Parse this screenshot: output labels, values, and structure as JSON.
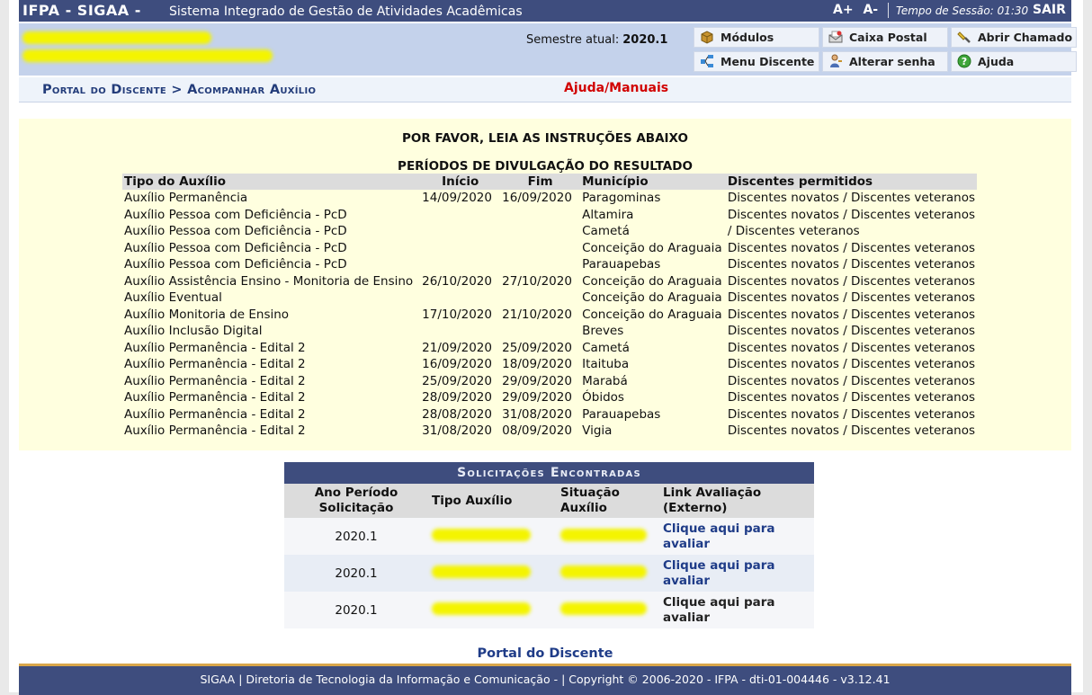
{
  "header": {
    "brand": "IFPA - SIGAA -",
    "system_name": "Sistema Integrado de Gestão de Atividades Acadêmicas",
    "font_increase": "A+",
    "font_decrease": "A-",
    "session": "Tempo de Sessão: 01:30",
    "logout": "SAIR"
  },
  "userbar": {
    "semester_label": "Semestre atual:",
    "semester_value": "2020.1",
    "menu": [
      {
        "label": "Módulos",
        "icon": "modules-icon"
      },
      {
        "label": "Caixa Postal",
        "icon": "mailbox-icon"
      },
      {
        "label": "Abrir Chamado",
        "icon": "flashlight-icon"
      },
      {
        "label": "Menu Discente",
        "icon": "menu-icon"
      },
      {
        "label": "Alterar senha",
        "icon": "user-key-icon"
      },
      {
        "label": "Ajuda",
        "icon": "help-icon"
      }
    ]
  },
  "breadcrumb": {
    "path": "Portal do Discente > Acompanhar Auxílio",
    "help": "Ajuda/Manuais"
  },
  "instructions": {
    "title": "POR FAVOR, LEIA AS INSTRUÇÕES ABAIXO",
    "subtitle": "PERÍODOS DE DIVULGAÇÃO DO RESULTADO",
    "columns": [
      "Tipo do Auxílio",
      "Início",
      "Fim",
      "Município",
      "Discentes permitidos"
    ],
    "rows": [
      [
        "Auxílio Permanência",
        "14/09/2020",
        "16/09/2020",
        "Paragominas",
        "Discentes novatos / Discentes veteranos"
      ],
      [
        "Auxílio Pessoa com Deficiência - PcD",
        "",
        "",
        "Altamira",
        "Discentes novatos / Discentes veteranos"
      ],
      [
        "Auxílio Pessoa com Deficiência - PcD",
        "",
        "",
        "Cametá",
        "/ Discentes veteranos"
      ],
      [
        "Auxílio Pessoa com Deficiência - PcD",
        "",
        "",
        "Conceição do Araguaia",
        "Discentes novatos / Discentes veteranos"
      ],
      [
        "Auxílio Pessoa com Deficiência - PcD",
        "",
        "",
        "Parauapebas",
        "Discentes novatos / Discentes veteranos"
      ],
      [
        "Auxílio Assistência Ensino - Monitoria de Ensino",
        "26/10/2020",
        "27/10/2020",
        "Conceição do Araguaia",
        "Discentes novatos / Discentes veteranos"
      ],
      [
        "Auxílio Eventual",
        "",
        "",
        "Conceição do Araguaia",
        "Discentes novatos / Discentes veteranos"
      ],
      [
        "Auxílio Monitoria de Ensino",
        "17/10/2020",
        "21/10/2020",
        "Conceição do Araguaia",
        "Discentes novatos / Discentes veteranos"
      ],
      [
        "Auxílio Inclusão Digital",
        "",
        "",
        "Breves",
        "Discentes novatos / Discentes veteranos"
      ],
      [
        "Auxílio Permanência - Edital 2",
        "21/09/2020",
        "25/09/2020",
        "Cametá",
        "Discentes novatos / Discentes veteranos"
      ],
      [
        "Auxílio Permanência - Edital 2",
        "16/09/2020",
        "18/09/2020",
        "Itaituba",
        "Discentes novatos / Discentes veteranos"
      ],
      [
        "Auxílio Permanência - Edital 2",
        "25/09/2020",
        "29/09/2020",
        "Marabá",
        "Discentes novatos / Discentes veteranos"
      ],
      [
        "Auxílio Permanência - Edital 2",
        "28/09/2020",
        "29/09/2020",
        "Óbidos",
        "Discentes novatos / Discentes veteranos"
      ],
      [
        "Auxílio Permanência - Edital 2",
        "28/08/2020",
        "31/08/2020",
        "Parauapebas",
        "Discentes novatos / Discentes veteranos"
      ],
      [
        "Auxílio Permanência - Edital 2",
        "31/08/2020",
        "08/09/2020",
        "Vigia",
        "Discentes novatos / Discentes veteranos"
      ]
    ]
  },
  "requests": {
    "title": "Solicitações Encontradas",
    "columns": {
      "year_line1": "Ano Período",
      "year_line2": "Solicitação",
      "type": "Tipo Auxílio",
      "status_line1": "Situação",
      "status_line2": "Auxílio",
      "link_line1": "Link Avaliação",
      "link_line2": "(Externo)"
    },
    "rows": [
      {
        "year": "2020.1",
        "link1": "Clique aqui para",
        "link2": "avaliar"
      },
      {
        "year": "2020.1",
        "link1": "Clique aqui para",
        "link2": "avaliar"
      },
      {
        "year": "2020.1",
        "link1": "Clique aqui para",
        "link2": "avaliar"
      }
    ]
  },
  "portal_link": "Portal do Discente",
  "footer": "SIGAA | Diretoria de Tecnologia da Informação e Comunicação - | Copyright © 2006-2020 - IFPA - dti-01-004446 - v3.12.41",
  "colors": {
    "header_bg": "#3e4d7e",
    "userbar_bg": "#c4d2eb",
    "instructions_bg": "#ffffdf",
    "link": "#1f3c88",
    "help_link": "#d10000",
    "footer_border": "#d8a64a"
  }
}
